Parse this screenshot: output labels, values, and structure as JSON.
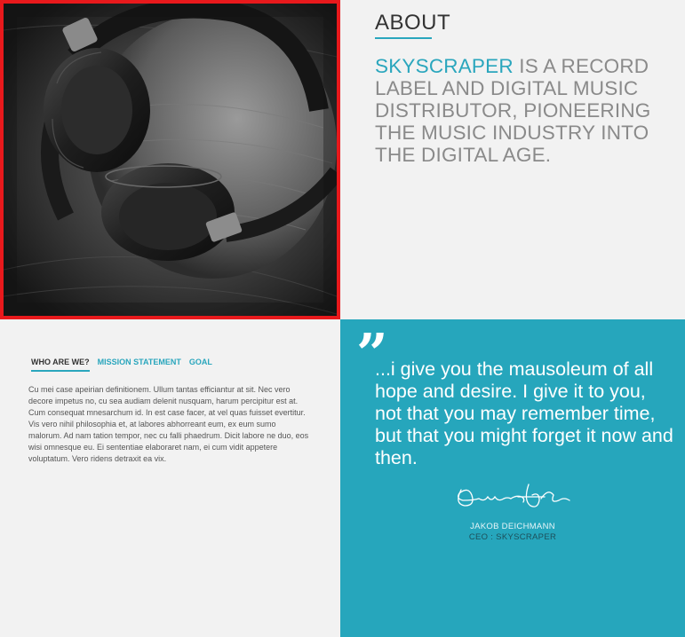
{
  "about": {
    "title": "ABOUT",
    "brand": "SKYSCRAPER",
    "description": " IS A RECORD LABEL AND DIGITAL MUSIC DISTRIBUTOR, PIONEERING THE MUSIC INDUSTRY INTO THE DIGITAL AGE."
  },
  "photo": {
    "icon": "headphones-photo"
  },
  "tabs": [
    {
      "label": "WHO ARE WE?",
      "active": true
    },
    {
      "label": "MISSION STATEMENT",
      "active": false
    },
    {
      "label": "GOAL",
      "active": false
    }
  ],
  "info": {
    "body": "Cu mei case apeirian definitionem. Ullum tantas efficiantur at sit. Nec vero decore impetus no, cu sea audiam delenit nusquam, harum percipitur est at. Cum consequat mnesarchum id. In est case facer, at vel quas fuisset evertitur. Vis vero nihil philosophia et, at labores abhorreant eum, ex eum sumo malorum. Ad nam tation tempor, nec cu falli phaedrum. Dicit labore ne duo, eos wisi omnesque eu. Ei sententiae elaboraret nam, ei cum vidit appetere voluptatum. Vero ridens detraxit ea vix."
  },
  "quote": {
    "mark": "”",
    "text": "...i give you the mausoleum of all hope and desire. I give it to you, not that you may remember time, but that you might forget it now and then.",
    "author": "JAKOB DEICHMANN",
    "role": "CEO : SKYSCRAPER"
  },
  "colors": {
    "accent": "#26a6bc",
    "photo_border": "#e8191c",
    "background": "#f2f2f2"
  }
}
